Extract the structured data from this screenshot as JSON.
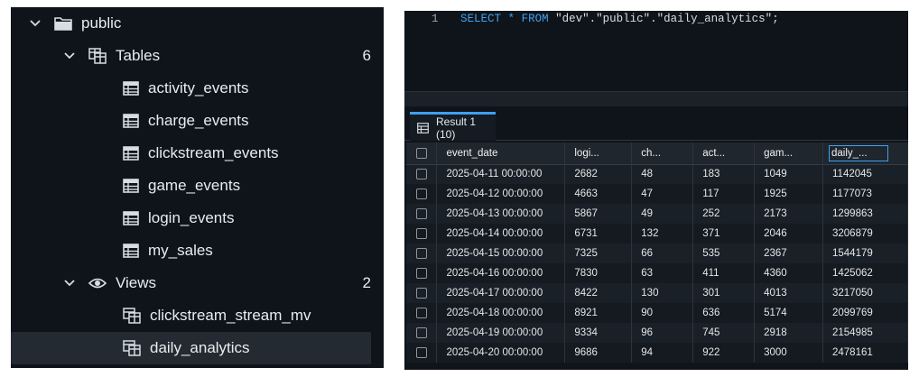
{
  "tree": {
    "schema": {
      "label": "public"
    },
    "tables_group": {
      "label": "Tables",
      "count": "6"
    },
    "tables": [
      {
        "label": "activity_events"
      },
      {
        "label": "charge_events"
      },
      {
        "label": "clickstream_events"
      },
      {
        "label": "game_events"
      },
      {
        "label": "login_events"
      },
      {
        "label": "my_sales"
      }
    ],
    "views_group": {
      "label": "Views",
      "count": "2"
    },
    "views": [
      {
        "label": "clickstream_stream_mv"
      },
      {
        "label": "daily_analytics"
      }
    ]
  },
  "editor": {
    "line_number": "1",
    "kw_select": "SELECT",
    "star": "*",
    "kw_from": "FROM",
    "q_db": "\"dev\"",
    "dot1": ".",
    "q_schema": "\"public\"",
    "dot2": ".",
    "q_table": "\"daily_analytics\"",
    "semicolon": ";"
  },
  "results": {
    "tab_label": "Result 1 (10)",
    "columns": [
      "event_date",
      "logi...",
      "ch...",
      "act...",
      "gam...",
      "daily_..."
    ],
    "rows": [
      [
        "2025-04-11 00:00:00",
        "2682",
        "48",
        "183",
        "1049",
        "1142045"
      ],
      [
        "2025-04-12 00:00:00",
        "4663",
        "47",
        "117",
        "1925",
        "1177073"
      ],
      [
        "2025-04-13 00:00:00",
        "5867",
        "49",
        "252",
        "2173",
        "1299863"
      ],
      [
        "2025-04-14 00:00:00",
        "6731",
        "132",
        "371",
        "2046",
        "3206879"
      ],
      [
        "2025-04-15 00:00:00",
        "7325",
        "66",
        "535",
        "2367",
        "1544179"
      ],
      [
        "2025-04-16 00:00:00",
        "7830",
        "63",
        "411",
        "4360",
        "1425062"
      ],
      [
        "2025-04-17 00:00:00",
        "8422",
        "130",
        "301",
        "4013",
        "3217050"
      ],
      [
        "2025-04-18 00:00:00",
        "8921",
        "90",
        "636",
        "5174",
        "2099769"
      ],
      [
        "2025-04-19 00:00:00",
        "9334",
        "96",
        "745",
        "2918",
        "2154985"
      ],
      [
        "2025-04-20 00:00:00",
        "9686",
        "94",
        "922",
        "3000",
        "2478161"
      ]
    ]
  },
  "colors": {
    "panel_bg": "#0f141a",
    "accent": "#3ea0f0",
    "selected_row": "#232a32"
  },
  "icons": {
    "chevron": "chevron-down-icon",
    "folder": "folder-icon",
    "tables": "tables-icon",
    "table": "table-icon",
    "views": "eye-icon",
    "view": "view-icon"
  }
}
